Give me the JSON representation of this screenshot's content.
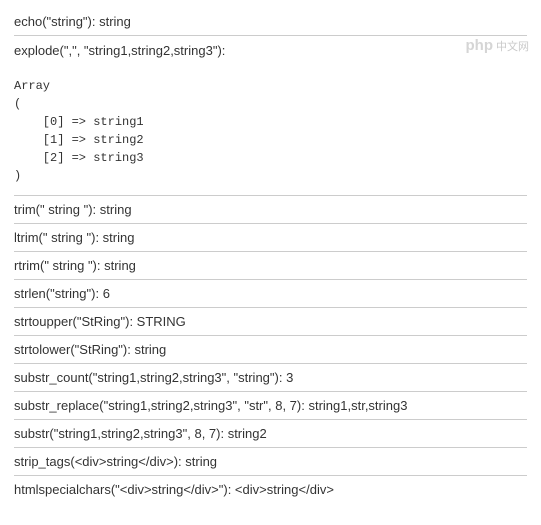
{
  "lines": {
    "echo": "echo(\"string\"):  string",
    "explode_header": "explode(\",\", \"string1,string2,string3\"):",
    "trim": "trim(\" string \"): string",
    "ltrim": "ltrim(\" string \"): string",
    "rtrim": "rtrim(\" string \"):  string",
    "strlen": "strlen(\"string\"): 6",
    "strtoupper": "strtoupper(\"StRing\"): STRING",
    "strtolower": "strtolower(\"StRing\"): string",
    "substr_count": "substr_count(\"string1,string2,string3\", \"string\"): 3",
    "substr_replace": "substr_replace(\"string1,string2,string3\", \"str\", 8, 7): string1,str,string3",
    "substr": "substr(\"string1,string2,string3\", 8, 7): string2",
    "strip_tags": "strip_tags(<div>string</div>): string",
    "htmlspecialchars": "htmlspecialchars(\"<div>string</div>\"): <div>string</div>"
  },
  "array_output": "Array\n(\n    [0] => string1\n    [1] => string2\n    [2] => string3\n)",
  "watermark": {
    "logo": "php",
    "text": "中文网"
  },
  "chart_data": {
    "type": "table",
    "title": "PHP String Function Examples",
    "rows": [
      {
        "function": "echo",
        "input": "\"string\"",
        "output": "string"
      },
      {
        "function": "explode",
        "input": "\",\", \"string1,string2,string3\"",
        "output": "Array([0]=>string1,[1]=>string2,[2]=>string3)"
      },
      {
        "function": "trim",
        "input": "\" string \"",
        "output": "string"
      },
      {
        "function": "ltrim",
        "input": "\" string \"",
        "output": "string"
      },
      {
        "function": "rtrim",
        "input": "\" string \"",
        "output": "string"
      },
      {
        "function": "strlen",
        "input": "\"string\"",
        "output": "6"
      },
      {
        "function": "strtoupper",
        "input": "\"StRing\"",
        "output": "STRING"
      },
      {
        "function": "strtolower",
        "input": "\"StRing\"",
        "output": "string"
      },
      {
        "function": "substr_count",
        "input": "\"string1,string2,string3\", \"string\"",
        "output": "3"
      },
      {
        "function": "substr_replace",
        "input": "\"string1,string2,string3\", \"str\", 8, 7",
        "output": "string1,str,string3"
      },
      {
        "function": "substr",
        "input": "\"string1,string2,string3\", 8, 7",
        "output": "string2"
      },
      {
        "function": "strip_tags",
        "input": "<div>string</div>",
        "output": "string"
      },
      {
        "function": "htmlspecialchars",
        "input": "\"<div>string</div>\"",
        "output": "<div>string</div>"
      }
    ]
  }
}
